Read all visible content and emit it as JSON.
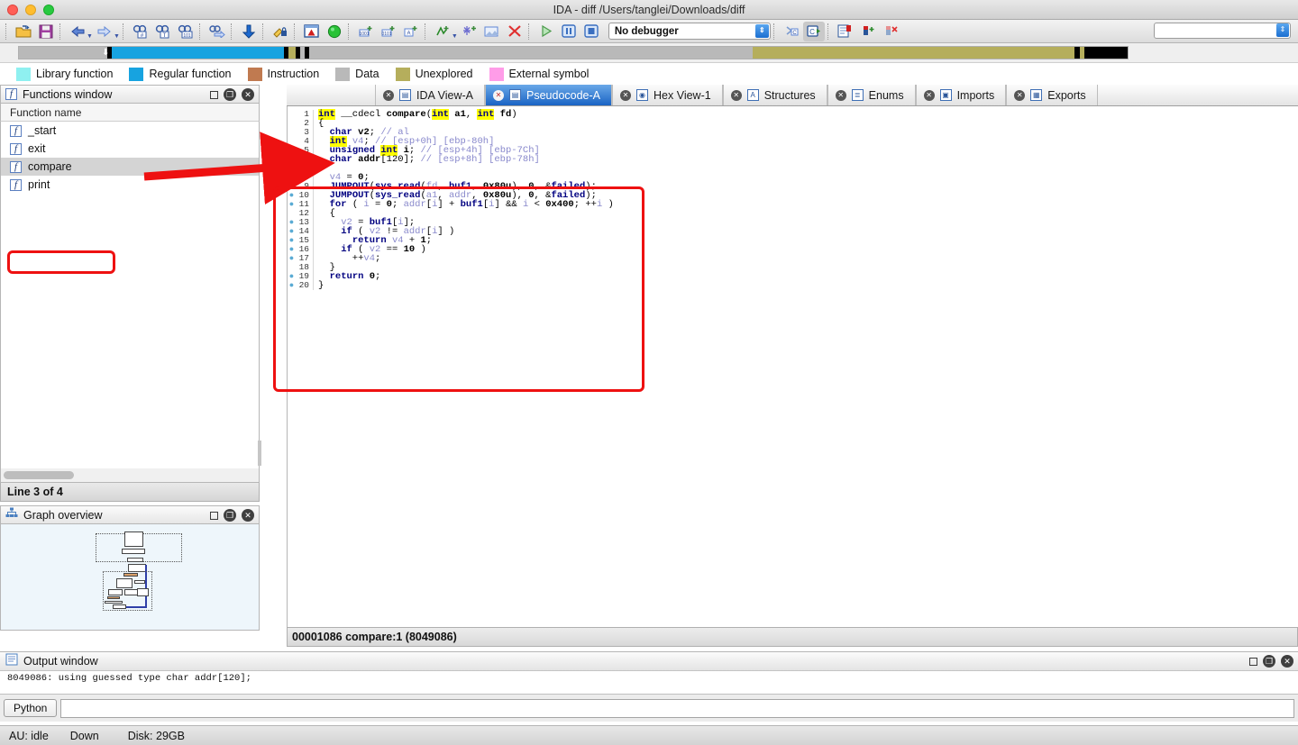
{
  "window": {
    "title": "IDA - diff /Users/tanglei/Downloads/diff",
    "traffic": {
      "close": "close-button",
      "minimize": "minimize-button",
      "zoom": "zoom-button"
    }
  },
  "toolbar": {
    "debugger_selected": "No debugger",
    "search_value": "",
    "icons": [
      "open-file-icon",
      "save-icon",
      "nav-back-icon",
      "nav-forward-icon",
      "search-number-icon",
      "search-text-icon",
      "search-sequence-icon",
      "jump-icon",
      "down-arrow-icon",
      "key-lock-icon",
      "warning-window-icon",
      "green-circle-icon",
      "create-data-icon",
      "create-array-icon",
      "create-struct-icon",
      "create-function-icon",
      "create-snowflake-icon",
      "image-icon",
      "delete-x-icon",
      "run-icon",
      "pause-icon",
      "stop-icon",
      "decompile-c-icon",
      "decompile-all-icon",
      "new-list-icon",
      "add-breakpoint-icon",
      "del-breakpoint-icon"
    ]
  },
  "navband": {
    "segments": [
      {
        "name": "data-left",
        "color": "#b9b9b9",
        "width": 8.0
      },
      {
        "name": "boundary-1",
        "color": "#000000",
        "width": 0.4
      },
      {
        "name": "regular-function",
        "color": "#17a3e0",
        "width": 15.5
      },
      {
        "name": "boundary-2",
        "color": "#000000",
        "width": 0.4
      },
      {
        "name": "unexplored-sliver",
        "color": "#b5ae5c",
        "width": 0.7
      },
      {
        "name": "boundary-3",
        "color": "#000000",
        "width": 0.4
      },
      {
        "name": "gap",
        "color": "#b9b9b9",
        "width": 0.4
      },
      {
        "name": "boundary-4",
        "color": "#000000",
        "width": 0.4
      },
      {
        "name": "data",
        "color": "#b9b9b9",
        "width": 40.0
      },
      {
        "name": "unexplored",
        "color": "#b5ae5c",
        "width": 29.0
      },
      {
        "name": "boundary-5",
        "color": "#000000",
        "width": 0.5
      },
      {
        "name": "gap-2",
        "color": "#b5ae5c",
        "width": 0.4
      },
      {
        "name": "boundary-6",
        "color": "#000000",
        "width": 0.5
      },
      {
        "name": "external",
        "color": "#000000",
        "width": 3.8
      }
    ],
    "cursor_glyph": "⬇"
  },
  "legend": [
    {
      "label": "Library function",
      "color": "#8ff0f0"
    },
    {
      "label": "Regular function",
      "color": "#17a3e0"
    },
    {
      "label": "Instruction",
      "color": "#c07a50"
    },
    {
      "label": "Data",
      "color": "#b9b9b9"
    },
    {
      "label": "Unexplored",
      "color": "#b5ae5c"
    },
    {
      "label": "External symbol",
      "color": "#ff9ce8"
    }
  ],
  "functions_window": {
    "title": "Functions window",
    "icon": "function-f-icon",
    "column_header": "Function name",
    "rows": [
      {
        "name": "_start",
        "selected": false
      },
      {
        "name": "exit",
        "selected": false
      },
      {
        "name": "compare",
        "selected": true
      },
      {
        "name": "print",
        "selected": false
      }
    ],
    "status": "Line 3 of 4",
    "buttons": {
      "restore": "restore-button",
      "detach": "detach-button",
      "close": "close-button"
    }
  },
  "graph_overview": {
    "title": "Graph overview",
    "icon": "graph-tree-icon",
    "buttons": {
      "restore": "restore-button",
      "detach": "detach-button",
      "close": "close-button"
    }
  },
  "tabs": [
    {
      "label": "IDA View-A",
      "icon": "ida-view-icon",
      "active": false
    },
    {
      "label": "Pseudocode-A",
      "icon": "pseudocode-icon",
      "active": true
    },
    {
      "label": "Hex View-1",
      "icon": "hex-view-icon",
      "active": false
    },
    {
      "label": "Structures",
      "icon": "structures-icon",
      "active": false
    },
    {
      "label": "Enums",
      "icon": "enums-icon",
      "active": false
    },
    {
      "label": "Imports",
      "icon": "imports-icon",
      "active": false
    },
    {
      "label": "Exports",
      "icon": "exports-icon",
      "active": false
    }
  ],
  "editor": {
    "status": "00001086  compare:1 (8049086)",
    "lines": [
      {
        "n": 1,
        "dot": false,
        "tokens": [
          {
            "t": "int",
            "c": "hl"
          },
          {
            "t": " __cdecl ",
            "c": "punc"
          },
          {
            "t": "compare",
            "c": "id"
          },
          {
            "t": "(",
            "c": "punc"
          },
          {
            "t": "int",
            "c": "hl"
          },
          {
            "t": " ",
            "c": "punc"
          },
          {
            "t": "a1",
            "c": "id"
          },
          {
            "t": ", ",
            "c": "punc"
          },
          {
            "t": "int",
            "c": "hl"
          },
          {
            "t": " ",
            "c": "punc"
          },
          {
            "t": "fd",
            "c": "id"
          },
          {
            "t": ")",
            "c": "punc"
          }
        ]
      },
      {
        "n": 2,
        "dot": false,
        "tokens": [
          {
            "t": "{",
            "c": "punc"
          }
        ]
      },
      {
        "n": 3,
        "dot": false,
        "tokens": [
          {
            "t": "  ",
            "c": "punc"
          },
          {
            "t": "char",
            "c": "kw"
          },
          {
            "t": " ",
            "c": "punc"
          },
          {
            "t": "v2",
            "c": "id"
          },
          {
            "t": "; ",
            "c": "punc"
          },
          {
            "t": "// al",
            "c": "cmt"
          }
        ]
      },
      {
        "n": 4,
        "dot": false,
        "tokens": [
          {
            "t": "  ",
            "c": "punc"
          },
          {
            "t": "int",
            "c": "hl"
          },
          {
            "t": " ",
            "c": "punc"
          },
          {
            "t": "v4",
            "c": "var"
          },
          {
            "t": "; ",
            "c": "punc"
          },
          {
            "t": "// [esp+0h] [ebp-80h]",
            "c": "cmt"
          }
        ]
      },
      {
        "n": 5,
        "dot": false,
        "tokens": [
          {
            "t": "  ",
            "c": "punc"
          },
          {
            "t": "unsigned",
            "c": "kw"
          },
          {
            "t": " ",
            "c": "punc"
          },
          {
            "t": "int",
            "c": "hl"
          },
          {
            "t": " ",
            "c": "punc"
          },
          {
            "t": "i",
            "c": "id"
          },
          {
            "t": "; ",
            "c": "punc"
          },
          {
            "t": "// [esp+4h] [ebp-7Ch]",
            "c": "cmt"
          }
        ]
      },
      {
        "n": 6,
        "dot": false,
        "tokens": [
          {
            "t": "  ",
            "c": "punc"
          },
          {
            "t": "char",
            "c": "kw"
          },
          {
            "t": " ",
            "c": "punc"
          },
          {
            "t": "addr",
            "c": "id"
          },
          {
            "t": "[120]; ",
            "c": "punc"
          },
          {
            "t": "// [esp+8h] [ebp-78h]",
            "c": "cmt"
          }
        ]
      },
      {
        "n": 7,
        "dot": false,
        "tokens": [
          {
            "t": " ",
            "c": "punc"
          }
        ]
      },
      {
        "n": 8,
        "dot": true,
        "tokens": [
          {
            "t": "  ",
            "c": "punc"
          },
          {
            "t": "v4",
            "c": "var"
          },
          {
            "t": " = ",
            "c": "punc"
          },
          {
            "t": "0",
            "c": "num"
          },
          {
            "t": ";",
            "c": "punc"
          }
        ]
      },
      {
        "n": 9,
        "dot": true,
        "tokens": [
          {
            "t": "  ",
            "c": "punc"
          },
          {
            "t": "JUMPOUT",
            "c": "kw"
          },
          {
            "t": "(",
            "c": "punc"
          },
          {
            "t": "sys_read",
            "c": "kw"
          },
          {
            "t": "(",
            "c": "punc"
          },
          {
            "t": "fd",
            "c": "var"
          },
          {
            "t": ", ",
            "c": "punc"
          },
          {
            "t": "buf1",
            "c": "kw"
          },
          {
            "t": ", ",
            "c": "punc"
          },
          {
            "t": "0x80u",
            "c": "num"
          },
          {
            "t": "), ",
            "c": "punc"
          },
          {
            "t": "0",
            "c": "num"
          },
          {
            "t": ", &",
            "c": "punc"
          },
          {
            "t": "failed",
            "c": "kw"
          },
          {
            "t": ");",
            "c": "punc"
          }
        ]
      },
      {
        "n": 10,
        "dot": true,
        "tokens": [
          {
            "t": "  ",
            "c": "punc"
          },
          {
            "t": "JUMPOUT",
            "c": "kw"
          },
          {
            "t": "(",
            "c": "punc"
          },
          {
            "t": "sys_read",
            "c": "kw"
          },
          {
            "t": "(",
            "c": "punc"
          },
          {
            "t": "a1",
            "c": "var"
          },
          {
            "t": ", ",
            "c": "punc"
          },
          {
            "t": "addr",
            "c": "var"
          },
          {
            "t": ", ",
            "c": "punc"
          },
          {
            "t": "0x80u",
            "c": "num"
          },
          {
            "t": "), ",
            "c": "punc"
          },
          {
            "t": "0",
            "c": "num"
          },
          {
            "t": ", &",
            "c": "punc"
          },
          {
            "t": "failed",
            "c": "kw"
          },
          {
            "t": ");",
            "c": "punc"
          }
        ]
      },
      {
        "n": 11,
        "dot": true,
        "tokens": [
          {
            "t": "  ",
            "c": "punc"
          },
          {
            "t": "for",
            "c": "kw"
          },
          {
            "t": " ( ",
            "c": "punc"
          },
          {
            "t": "i",
            "c": "var"
          },
          {
            "t": " = ",
            "c": "punc"
          },
          {
            "t": "0",
            "c": "num"
          },
          {
            "t": "; ",
            "c": "punc"
          },
          {
            "t": "addr",
            "c": "var"
          },
          {
            "t": "[",
            "c": "punc"
          },
          {
            "t": "i",
            "c": "var"
          },
          {
            "t": "] + ",
            "c": "punc"
          },
          {
            "t": "buf1",
            "c": "kw"
          },
          {
            "t": "[",
            "c": "punc"
          },
          {
            "t": "i",
            "c": "var"
          },
          {
            "t": "] && ",
            "c": "punc"
          },
          {
            "t": "i",
            "c": "var"
          },
          {
            "t": " < ",
            "c": "punc"
          },
          {
            "t": "0x400",
            "c": "num"
          },
          {
            "t": "; ++",
            "c": "punc"
          },
          {
            "t": "i",
            "c": "var"
          },
          {
            "t": " )",
            "c": "punc"
          }
        ]
      },
      {
        "n": 12,
        "dot": false,
        "tokens": [
          {
            "t": "  {",
            "c": "punc"
          }
        ]
      },
      {
        "n": 13,
        "dot": true,
        "tokens": [
          {
            "t": "    ",
            "c": "punc"
          },
          {
            "t": "v2",
            "c": "var"
          },
          {
            "t": " = ",
            "c": "punc"
          },
          {
            "t": "buf1",
            "c": "kw"
          },
          {
            "t": "[",
            "c": "punc"
          },
          {
            "t": "i",
            "c": "var"
          },
          {
            "t": "];",
            "c": "punc"
          }
        ]
      },
      {
        "n": 14,
        "dot": true,
        "tokens": [
          {
            "t": "    ",
            "c": "punc"
          },
          {
            "t": "if",
            "c": "kw"
          },
          {
            "t": " ( ",
            "c": "punc"
          },
          {
            "t": "v2",
            "c": "var"
          },
          {
            "t": " != ",
            "c": "punc"
          },
          {
            "t": "addr",
            "c": "var"
          },
          {
            "t": "[",
            "c": "punc"
          },
          {
            "t": "i",
            "c": "var"
          },
          {
            "t": "] )",
            "c": "punc"
          }
        ]
      },
      {
        "n": 15,
        "dot": true,
        "tokens": [
          {
            "t": "      ",
            "c": "punc"
          },
          {
            "t": "return",
            "c": "kw"
          },
          {
            "t": " ",
            "c": "punc"
          },
          {
            "t": "v4",
            "c": "var"
          },
          {
            "t": " + ",
            "c": "punc"
          },
          {
            "t": "1",
            "c": "num"
          },
          {
            "t": ";",
            "c": "punc"
          }
        ]
      },
      {
        "n": 16,
        "dot": true,
        "tokens": [
          {
            "t": "    ",
            "c": "punc"
          },
          {
            "t": "if",
            "c": "kw"
          },
          {
            "t": " ( ",
            "c": "punc"
          },
          {
            "t": "v2",
            "c": "var"
          },
          {
            "t": " == ",
            "c": "punc"
          },
          {
            "t": "10",
            "c": "num"
          },
          {
            "t": " )",
            "c": "punc"
          }
        ]
      },
      {
        "n": 17,
        "dot": true,
        "tokens": [
          {
            "t": "      ++",
            "c": "punc"
          },
          {
            "t": "v4",
            "c": "var"
          },
          {
            "t": ";",
            "c": "punc"
          }
        ]
      },
      {
        "n": 18,
        "dot": false,
        "tokens": [
          {
            "t": "  }",
            "c": "punc"
          }
        ]
      },
      {
        "n": 19,
        "dot": true,
        "tokens": [
          {
            "t": "  ",
            "c": "punc"
          },
          {
            "t": "return",
            "c": "kw"
          },
          {
            "t": " ",
            "c": "punc"
          },
          {
            "t": "0",
            "c": "num"
          },
          {
            "t": ";",
            "c": "punc"
          }
        ]
      },
      {
        "n": 20,
        "dot": true,
        "tokens": [
          {
            "t": "}",
            "c": "punc"
          }
        ]
      }
    ]
  },
  "output_window": {
    "title": "Output window",
    "icon": "output-list-icon",
    "text": "8049086: using guessed type char addr[120];",
    "cli_button": "Python",
    "cli_value": ""
  },
  "statusbar": {
    "au": "AU: idle",
    "direction": "Down",
    "disk": "Disk: 29GB"
  },
  "annotations": {
    "highlight_color": "#ee1111",
    "arrow_from": "compare-function-row",
    "arrow_to": "pseudocode-panel"
  }
}
